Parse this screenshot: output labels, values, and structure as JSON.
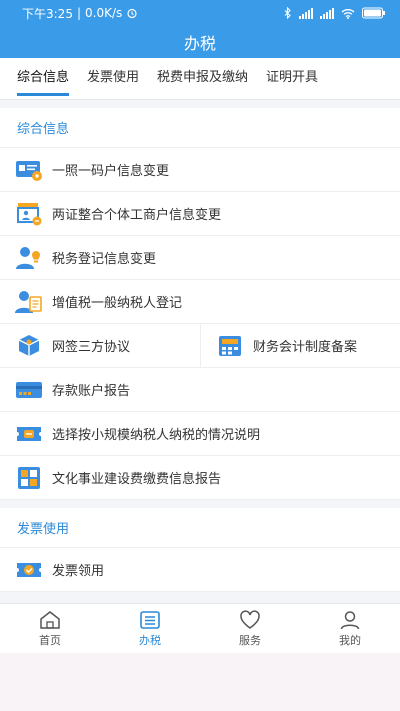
{
  "status": {
    "time": "下午3:25",
    "speed": "0.0K/s",
    "battery": ""
  },
  "header": {
    "title": "办税"
  },
  "tabs": [
    {
      "label": "综合信息",
      "active": true
    },
    {
      "label": "发票使用",
      "active": false
    },
    {
      "label": "税费申报及缴纳",
      "active": false
    },
    {
      "label": "证明开具",
      "active": false
    }
  ],
  "sections": {
    "general": {
      "title": "综合信息",
      "items": [
        {
          "label": "一照一码户信息变更",
          "icon": "id-card-icon"
        },
        {
          "label": "两证整合个体工商户信息变更",
          "icon": "storefront-icon"
        },
        {
          "label": "税务登记信息变更",
          "icon": "person-lightbulb-icon"
        },
        {
          "label": "增值税一般纳税人登记",
          "icon": "person-document-icon"
        }
      ],
      "split_row": [
        {
          "label": "网签三方协议",
          "icon": "box-icon"
        },
        {
          "label": "财务会计制度备案",
          "icon": "calculator-icon"
        }
      ],
      "items_after": [
        {
          "label": "存款账户报告",
          "icon": "bank-card-icon"
        },
        {
          "label": "选择按小规模纳税人纳税的情况说明",
          "icon": "ticket-icon"
        },
        {
          "label": "文化事业建设费缴费信息报告",
          "icon": "building-icon"
        }
      ]
    },
    "invoice": {
      "title": "发票使用",
      "items": [
        {
          "label": "发票领用",
          "icon": "invoice-check-icon"
        }
      ]
    }
  },
  "bottom_nav": [
    {
      "label": "首页",
      "icon": "home-icon",
      "active": false
    },
    {
      "label": "办税",
      "icon": "list-icon",
      "active": true
    },
    {
      "label": "服务",
      "icon": "heart-icon",
      "active": false
    },
    {
      "label": "我的",
      "icon": "user-icon",
      "active": false
    }
  ],
  "colors": {
    "primary": "#3a9be8",
    "accent": "#2a8ad8",
    "icon_orange": "#f5a623",
    "icon_blue": "#3b8de0"
  }
}
